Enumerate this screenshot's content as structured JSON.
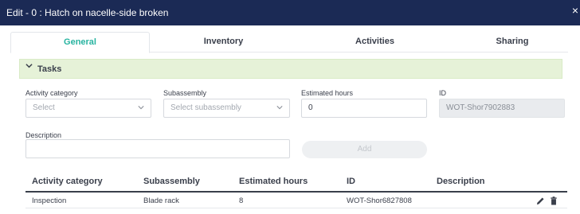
{
  "window": {
    "title": "Edit - 0 : Hatch on nacelle-side broken",
    "close_glyph": "×"
  },
  "tabs": [
    {
      "label": "General",
      "active": true
    },
    {
      "label": "Inventory",
      "active": false
    },
    {
      "label": "Activities",
      "active": false
    },
    {
      "label": "Sharing",
      "active": false
    }
  ],
  "section": {
    "title": "Tasks",
    "icon": "chevron-down-icon"
  },
  "form": {
    "activity_category": {
      "label": "Activity category",
      "placeholder": "Select"
    },
    "subassembly": {
      "label": "Subassembly",
      "placeholder": "Select subassembly"
    },
    "estimated_hours": {
      "label": "Estimated hours",
      "value": "0"
    },
    "id": {
      "label": "ID",
      "value": "WOT-Shor7902883"
    },
    "description": {
      "label": "Description",
      "value": ""
    },
    "add_label": "Add"
  },
  "table": {
    "headers": [
      "Activity category",
      "Subassembly",
      "Estimated hours",
      "ID",
      "Description"
    ],
    "rows": [
      {
        "activity_category": "Inspection",
        "subassembly": "Blade rack",
        "estimated_hours": "8",
        "id": "WOT-Shor6827808",
        "description": ""
      }
    ]
  },
  "colors": {
    "titlebar": "#1b2a55",
    "accent": "#27b3a0",
    "section_bg": "#e6f2d8"
  }
}
